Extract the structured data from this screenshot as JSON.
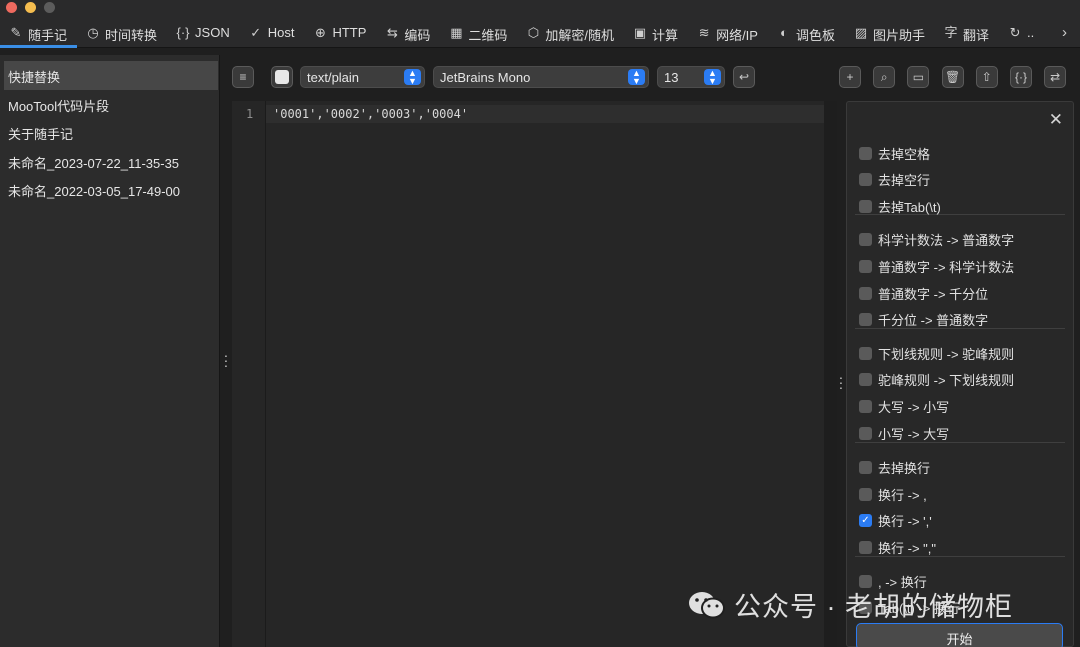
{
  "window": {
    "traffic_colors": [
      "#ee6a5f",
      "#f5bd4f",
      "#5c5c5c"
    ]
  },
  "tabs": [
    {
      "label": "随手记",
      "icon": "pencil-icon",
      "glyph": "✎",
      "active": true
    },
    {
      "label": "时间转换",
      "icon": "clock-icon",
      "glyph": "◷"
    },
    {
      "label": "JSON",
      "icon": "braces-icon",
      "glyph": "{·}"
    },
    {
      "label": "Host",
      "icon": "check-icon",
      "glyph": "✓"
    },
    {
      "label": "HTTP",
      "icon": "globe-icon",
      "glyph": "⊕"
    },
    {
      "label": "编码",
      "icon": "swap-icon",
      "glyph": "⇆"
    },
    {
      "label": "二维码",
      "icon": "qrcode-icon",
      "glyph": "▦"
    },
    {
      "label": "加解密/随机",
      "icon": "cube-icon",
      "glyph": "⬡"
    },
    {
      "label": "计算",
      "icon": "calculator-icon",
      "glyph": "▣"
    },
    {
      "label": "网络/IP",
      "icon": "wifi-icon",
      "glyph": "≋"
    },
    {
      "label": "调色板",
      "icon": "palette-icon",
      "glyph": "◐"
    },
    {
      "label": "图片助手",
      "icon": "image-icon",
      "glyph": "▨"
    },
    {
      "label": "翻译",
      "icon": "translate-icon",
      "glyph": "字"
    },
    {
      "label": "..",
      "icon": "refresh-icon",
      "glyph": "↻"
    }
  ],
  "tabs_overflow": "›",
  "sidebar": {
    "items": [
      {
        "label": "快捷替换",
        "selected": true
      },
      {
        "label": "MooTool代码片段"
      },
      {
        "label": "关于随手记"
      },
      {
        "label": "未命名_2023-07-22_11-35-35"
      },
      {
        "label": "未命名_2022-03-05_17-49-00"
      }
    ]
  },
  "toolbar": {
    "menu_icon": "≡",
    "syntax": "text/plain",
    "font": "JetBrains Mono",
    "font_size": "13",
    "select_arrow": "⌃⌄",
    "wrap_icon": "↩",
    "right_icons": [
      {
        "name": "add-icon",
        "glyph": "+"
      },
      {
        "name": "search-icon",
        "glyph": "⌕"
      },
      {
        "name": "save-icon",
        "glyph": "▭"
      },
      {
        "name": "delete-icon",
        "glyph": "🗑"
      },
      {
        "name": "share-icon",
        "glyph": "⇧"
      },
      {
        "name": "format-icon",
        "glyph": "{·}"
      },
      {
        "name": "swap-icon",
        "glyph": "⇄"
      }
    ]
  },
  "editor": {
    "line_number": "1",
    "content": "'0001','0002','0003','0004'"
  },
  "panel": {
    "close_glyph": "✕",
    "options": [
      {
        "label": "去掉空格",
        "checked": false
      },
      {
        "label": "去掉空行",
        "checked": false
      },
      {
        "label": "去掉Tab(\\t)",
        "checked": false
      },
      {
        "label": "科学计数法 -> 普通数字",
        "checked": false
      },
      {
        "label": "普通数字 -> 科学计数法",
        "checked": false
      },
      {
        "label": "普通数字 -> 千分位",
        "checked": false
      },
      {
        "label": "千分位 -> 普通数字",
        "checked": false
      },
      {
        "label": "下划线规则 -> 驼峰规则",
        "checked": false
      },
      {
        "label": "驼峰规则 -> 下划线规则",
        "checked": false
      },
      {
        "label": "大写 -> 小写",
        "checked": false
      },
      {
        "label": "小写 -> 大写",
        "checked": false
      },
      {
        "label": "去掉换行",
        "checked": false
      },
      {
        "label": "换行 -> ,",
        "checked": false
      },
      {
        "label": "换行 -> ','",
        "checked": true
      },
      {
        "label": "换行 -> \",\"",
        "checked": false
      },
      {
        "label": ", -> 换行",
        "checked": false
      },
      {
        "label": "Tab(\\t) -> 换行",
        "checked": false
      }
    ],
    "start_label": "开始"
  },
  "watermark": {
    "text": "公众号 · 老胡的储物柜"
  }
}
